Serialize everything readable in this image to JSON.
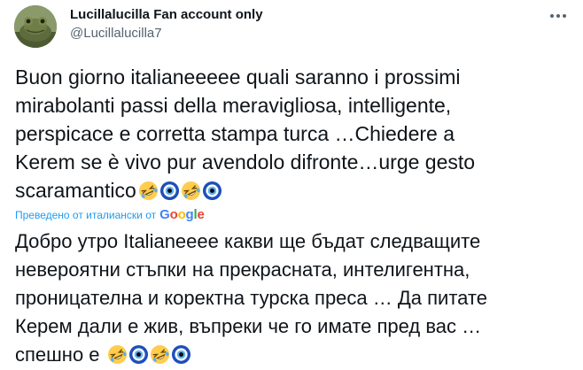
{
  "tweet": {
    "display_name": "Lucillalucilla Fan account only",
    "handle": "@Lucillalucilla7",
    "text": "Buon giorno italianeeeee  quali saranno i prossimi\nmirabolanti passi della meravigliosa, intelligente,\nperspicace e corretta stampa turca …Chiedere a\nKerem se è vivo pur avendolo  difronte…urge gesto\nscaramantico",
    "text_emojis": [
      "rolling-laughing",
      "nazar-amulet",
      "rolling-laughing",
      "nazar-amulet"
    ],
    "translation_note": "Преведено от италиански от",
    "translation_provider": [
      "G",
      "o",
      "o",
      "g",
      "l",
      "e"
    ],
    "translated_text": "Добро утро Italianeeee какви ще бъдат следващите\nневероятни стъпки на прекрасната, интелигентна,\nпроницателна и коректна турска преса … Да питате\nКерем дали е жив, въпреки че го имате пред вас …\nспешно е ",
    "translated_emojis": [
      "rolling-laughing",
      "nazar-amulet",
      "rolling-laughing",
      "nazar-amulet"
    ]
  },
  "icons": {
    "more": "more-horizontal-icon",
    "avatar": "frog-avatar"
  },
  "colors": {
    "text_primary": "#0f1419",
    "text_secondary": "#536471",
    "link_blue": "#1d9bf0",
    "google_blue": "#4285f4",
    "google_red": "#ea4335",
    "google_yellow": "#fbbc05",
    "google_green": "#34a853"
  }
}
